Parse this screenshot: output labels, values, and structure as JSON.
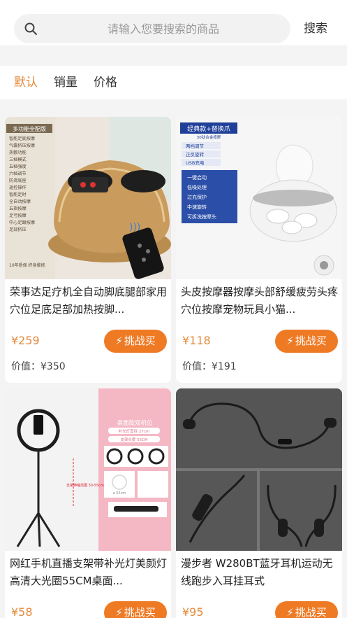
{
  "search": {
    "placeholder": "请输入您要搜索的商品",
    "button_label": "搜索"
  },
  "sort_tabs": [
    {
      "label": "默认",
      "active": true
    },
    {
      "label": "销量",
      "active": false
    },
    {
      "label": "价格",
      "active": false
    }
  ],
  "products": [
    {
      "title": "荣事达足疗机全自动脚底腿部家用穴位足底足部加热按脚...",
      "price": "¥259",
      "value": "价值：¥350",
      "button": "挑战买",
      "image": {
        "badge": "多功能全配版",
        "features": [
          "智能足底按摩",
          "气囊挤压按摩",
          "热敷功能",
          "三档模式",
          "五档强度",
          "六档调节",
          "防滑底座",
          "遥控操作",
          "智能定时",
          "全自动按摩",
          "五指按摩",
          "足弓按摩",
          "中心足跟按摩",
          "足部挤压"
        ],
        "footer": "10年质保 终身维修"
      }
    },
    {
      "title": "头皮按摩器按摩头部舒缓疲劳头疼穴位按摩宠物玩具小猫...",
      "price": "¥118",
      "value": "价值：¥191",
      "button": "挑战买",
      "image": {
        "badge": "经典款+替换爪",
        "badge_sub": "30钛合金按摩",
        "features_top": [
          "两档调节",
          "正反旋转",
          "USB充电"
        ],
        "features_bottom": [
          "一键启动",
          "低噪处理",
          "过充保护",
          "中速旋转",
          "可拆洗按摩头"
        ]
      }
    },
    {
      "title": "网红手机直播支架带补光灯美颜灯高清大光圈55CM桌面...",
      "price": "¥58",
      "value": "",
      "button": "挑战买",
      "image": {
        "panel_title": "桌面款双机位",
        "panel_sub1": "补光灯直径 27cm",
        "panel_sub2": "支架长度 55CM",
        "panel_note": "a 55cm",
        "stand_note": "支架伸缩范围 30-55cm"
      }
    },
    {
      "title": "漫步者 W280BT蓝牙耳机运动无线跑步入耳挂耳式",
      "price": "¥95",
      "value": "",
      "button": "挑战买",
      "image": {}
    }
  ],
  "colors": {
    "accent": "#e48a3c",
    "button": "#ef7a24",
    "feature_bg": "#2b4fa8"
  }
}
